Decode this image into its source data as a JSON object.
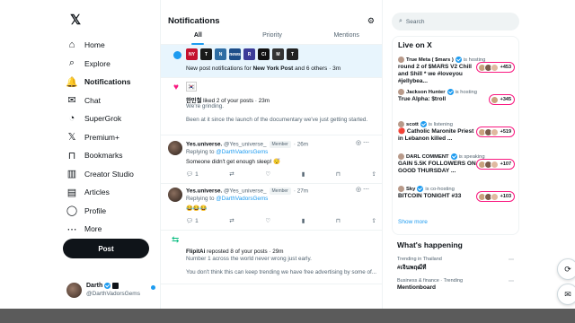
{
  "nav": {
    "items": [
      {
        "label": "Home",
        "icon": "home-icon",
        "glyph": "⌂"
      },
      {
        "label": "Explore",
        "icon": "search-icon",
        "glyph": "⌕"
      },
      {
        "label": "Notifications",
        "icon": "bell-icon",
        "glyph": "🔔"
      },
      {
        "label": "Chat",
        "icon": "chat-icon",
        "glyph": "✉"
      },
      {
        "label": "SuperGrok",
        "icon": "grok-icon",
        "glyph": "◔"
      },
      {
        "label": "Premium+",
        "icon": "premium-icon",
        "glyph": "𝕏"
      },
      {
        "label": "Bookmarks",
        "icon": "bookmark-icon",
        "glyph": "⊓"
      },
      {
        "label": "Creator Studio",
        "icon": "creator-studio-icon",
        "glyph": "▥"
      },
      {
        "label": "Articles",
        "icon": "articles-icon",
        "glyph": "▤"
      },
      {
        "label": "Profile",
        "icon": "profile-icon",
        "glyph": "◯"
      },
      {
        "label": "More",
        "icon": "more-icon",
        "glyph": "⋯"
      }
    ],
    "post_label": "Post",
    "profile": {
      "name": "Darth",
      "handle": "@DarthVadorsGems"
    }
  },
  "main": {
    "title": "Notifications",
    "tabs": [
      "All",
      "Priority",
      "Mentions"
    ],
    "new_posts": {
      "prefix": "New post notifications for ",
      "account": "New York Post",
      "suffix": " and 6 others · 3m",
      "avatar_colors": [
        "#c4122f",
        "#1a1a1a",
        "#2e6da4",
        "#1d4e89",
        "#3b3b98",
        "#111111",
        "#333333",
        "#222222"
      ],
      "avatar_labels": [
        "NY",
        "T",
        "N",
        "news",
        "R",
        "CI",
        "M",
        "T"
      ]
    },
    "like1": {
      "flag": "🇰🇷",
      "actor": "한민철",
      "action": " liked 2 of your posts · 23m",
      "line2": "We're grinding.",
      "line3": "Been at it since the launch of the documentary we've just getting started."
    },
    "reply1": {
      "name": "Yes.universe.",
      "handle": "@Yes_universe_",
      "badge": "Member",
      "time": "· 26m",
      "replying": "Replying to ",
      "replying_to": "@DarthVadorsGems",
      "text": "Someone didn't get enough sleep! 😴",
      "reply_count": "1"
    },
    "reply2": {
      "name": "Yes.universe.",
      "handle": "@Yes_universe_",
      "badge": "Member",
      "time": "· 27m",
      "replying": "Replying to ",
      "replying_to": "@DarthVadorsGems",
      "text": "😂😂😂",
      "reply_count": "1"
    },
    "repost1": {
      "actor": "FlipitAi",
      "action": " reposted 8 of your posts · 29m",
      "line2": "Number 1 across the world never wrong just early.",
      "line3": "You don't think this can keep trending we have free advertising by some of..."
    }
  },
  "right": {
    "search_placeholder": "Search",
    "live_title": "Live on X",
    "live": [
      {
        "host": "True Meta ( $mars )",
        "status": "is hosting",
        "text": "round 2 of $MARS V2 Chill and Shill * we #loveyou #jellybea...",
        "count": "+453"
      },
      {
        "host": "Jackson Hunter",
        "status": "is hosting",
        "text": "True Alpha: $troll",
        "count": "+345"
      },
      {
        "host": "scott",
        "status": "is listening",
        "text": "🔴 Catholic Maronite Priest in Lebanon killed ...",
        "count": "+519"
      },
      {
        "host": "DARL COMMENT",
        "status": "is speaking",
        "text": "GAIN 5.5K FOLLOWERS ON GOOD THURSDAY ...",
        "count": "+107"
      },
      {
        "host": "Sky",
        "status": "is co-hosting",
        "text": "BITCOIN TONIGHT #33",
        "count": "+103"
      }
    ],
    "show_more": "Show more",
    "happening_title": "What's happening",
    "trends": [
      {
        "meta": "Trending in Thailand",
        "name": "#เจินพฤฒีที"
      },
      {
        "meta": "Business & finance · Trending",
        "name": "Mentionboard"
      }
    ]
  },
  "colors": {
    "accent": "#1d9bf0",
    "like": "#f91880",
    "repost": "#00ba7c",
    "text": "#0f1419",
    "muted": "#536471"
  }
}
